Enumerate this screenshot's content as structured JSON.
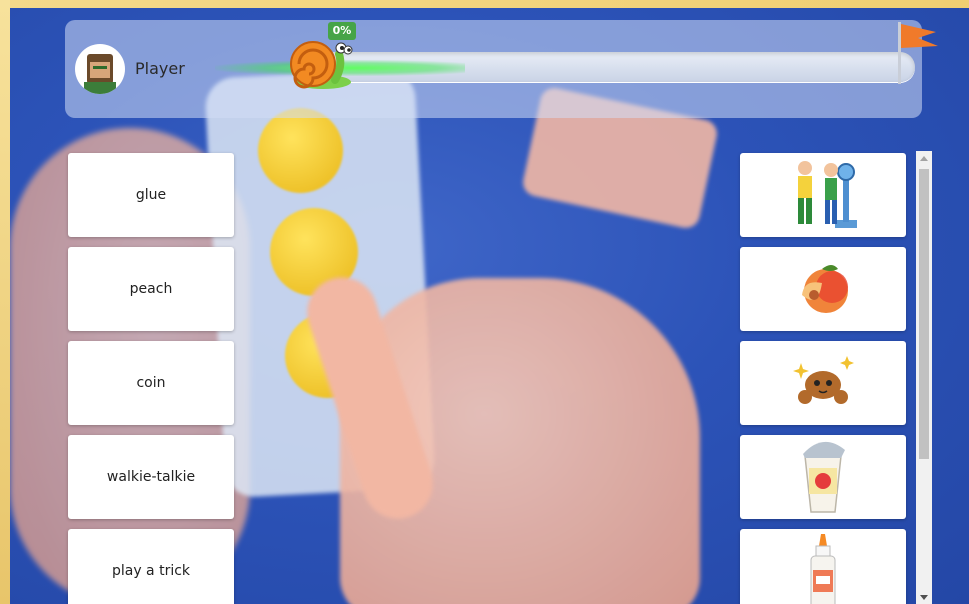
{
  "header": {
    "player_name": "Player",
    "progress_label": "0%",
    "progress_value": 0
  },
  "words": [
    {
      "label": "glue"
    },
    {
      "label": "peach"
    },
    {
      "label": "coin"
    },
    {
      "label": "walkie-talkie"
    },
    {
      "label": "play a trick"
    }
  ],
  "pictures": [
    {
      "icon": "two-men-weighing-scale-icon"
    },
    {
      "icon": "peach-icon"
    },
    {
      "icon": "crab-icon"
    },
    {
      "icon": "yogurt-cup-icon"
    },
    {
      "icon": "glue-bottle-icon"
    }
  ],
  "colors": {
    "background": "#2c53b8",
    "progress_glow": "#3fe65a",
    "percent_badge": "#46a447",
    "flag": "#f07a2a"
  }
}
